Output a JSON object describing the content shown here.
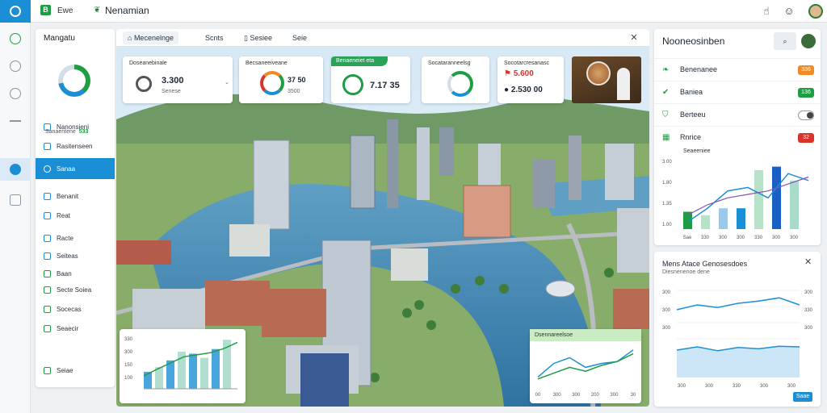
{
  "app": {
    "brand": "Ewe",
    "title": "Nenamian"
  },
  "colors": {
    "primary": "#1a8fd6",
    "accent": "#1f9d43",
    "warning": "#f08a24",
    "danger": "#d9342b"
  },
  "topbar": {
    "icons": [
      "thumb-icon",
      "face-icon"
    ]
  },
  "nav": {
    "title": "Mangatu",
    "stat_label": "Sanaentene",
    "stat_value": "533",
    "items": [
      {
        "label": "Nanonsieni",
        "active": false
      },
      {
        "label": "Rasitenseen",
        "active": false
      },
      {
        "label": "Sanaa",
        "active": true
      },
      {
        "label": "Benanit",
        "active": false
      },
      {
        "label": "Reat",
        "active": false
      },
      {
        "label": "Racte",
        "active": false
      },
      {
        "label": "Seiteas",
        "active": false
      },
      {
        "label": "Baan",
        "active": false
      },
      {
        "label": "Secte Soiea",
        "active": false
      },
      {
        "label": "Socecas",
        "active": false
      },
      {
        "label": "Seaecir",
        "active": false
      },
      {
        "label": "Seiae",
        "active": false
      }
    ]
  },
  "tabs": [
    {
      "label": "Mecenelnge",
      "active": true
    },
    {
      "label": "Scnts",
      "active": false
    },
    {
      "label": "Sesiee",
      "active": false
    },
    {
      "label": "Seie",
      "active": false
    }
  ],
  "kpis": [
    {
      "title": "Doseanebinale",
      "value": "3.300",
      "sub": "Senese"
    },
    {
      "title": "Becsaneeiveane",
      "value": "37 50",
      "sub": "3500"
    },
    {
      "title": "Benaeneiet eta",
      "value": "7.17 35",
      "sub": ""
    },
    {
      "title": "Socataranneelsg",
      "value": "",
      "sub": ""
    },
    {
      "title": "Socotarcresanasc",
      "value": "5.600",
      "sub": "2.530 00"
    }
  ],
  "map_card_left": {
    "bars": [
      0.33,
      0.42,
      0.55,
      0.72,
      0.68,
      0.6,
      0.77,
      0.95
    ],
    "line": [
      0.25,
      0.38,
      0.5,
      0.62,
      0.66,
      0.7,
      0.78,
      0.9
    ],
    "yticks": [
      "330",
      "300",
      "150",
      "100"
    ]
  },
  "map_card_right": {
    "title": "Dsennareelsoe",
    "line1": [
      0.2,
      0.55,
      0.7,
      0.45,
      0.55,
      0.6,
      0.9
    ],
    "line2": [
      0.15,
      0.3,
      0.45,
      0.35,
      0.5,
      0.6,
      0.8
    ],
    "xticks": [
      "00",
      "300",
      "300",
      "200",
      "300",
      "30"
    ]
  },
  "right_panel": {
    "title": "Nooneosinben",
    "rows": [
      {
        "label": "Benenanee",
        "badge": "336",
        "badge_color": "#f08a24",
        "icon": "leaf-icon"
      },
      {
        "label": "Baniea",
        "badge": "136",
        "badge_color": "#1f9d43",
        "icon": "check-icon"
      },
      {
        "label": "Berteeu",
        "badge": "",
        "badge_color": "",
        "icon": "shield-icon"
      },
      {
        "label": "Rnrice",
        "badge": "32",
        "badge_color": "#d9342b",
        "icon": "grid-icon"
      }
    ],
    "chart_title": "Seaeeniee",
    "yticks": [
      "3.00",
      "1.80",
      "1.35",
      "1.00"
    ],
    "xticks": [
      "Sae",
      "330",
      "300",
      "300",
      "330",
      "300",
      "300"
    ]
  },
  "trend": {
    "title": "Mens Atace Genosesdoes",
    "sub": "Diesnenenoe dene",
    "yticks_top": [
      "300",
      "300",
      "300"
    ],
    "yticks_bottom": [
      "300",
      "330",
      "300"
    ],
    "xticks": [
      "300",
      "300",
      "330",
      "300",
      "300"
    ],
    "line_top": [
      0.35,
      0.5,
      0.42,
      0.55,
      0.62,
      0.72,
      0.5
    ],
    "line_bottom": [
      0.4,
      0.5,
      0.38,
      0.48,
      0.44,
      0.52,
      0.5
    ],
    "button": "Saae"
  }
}
